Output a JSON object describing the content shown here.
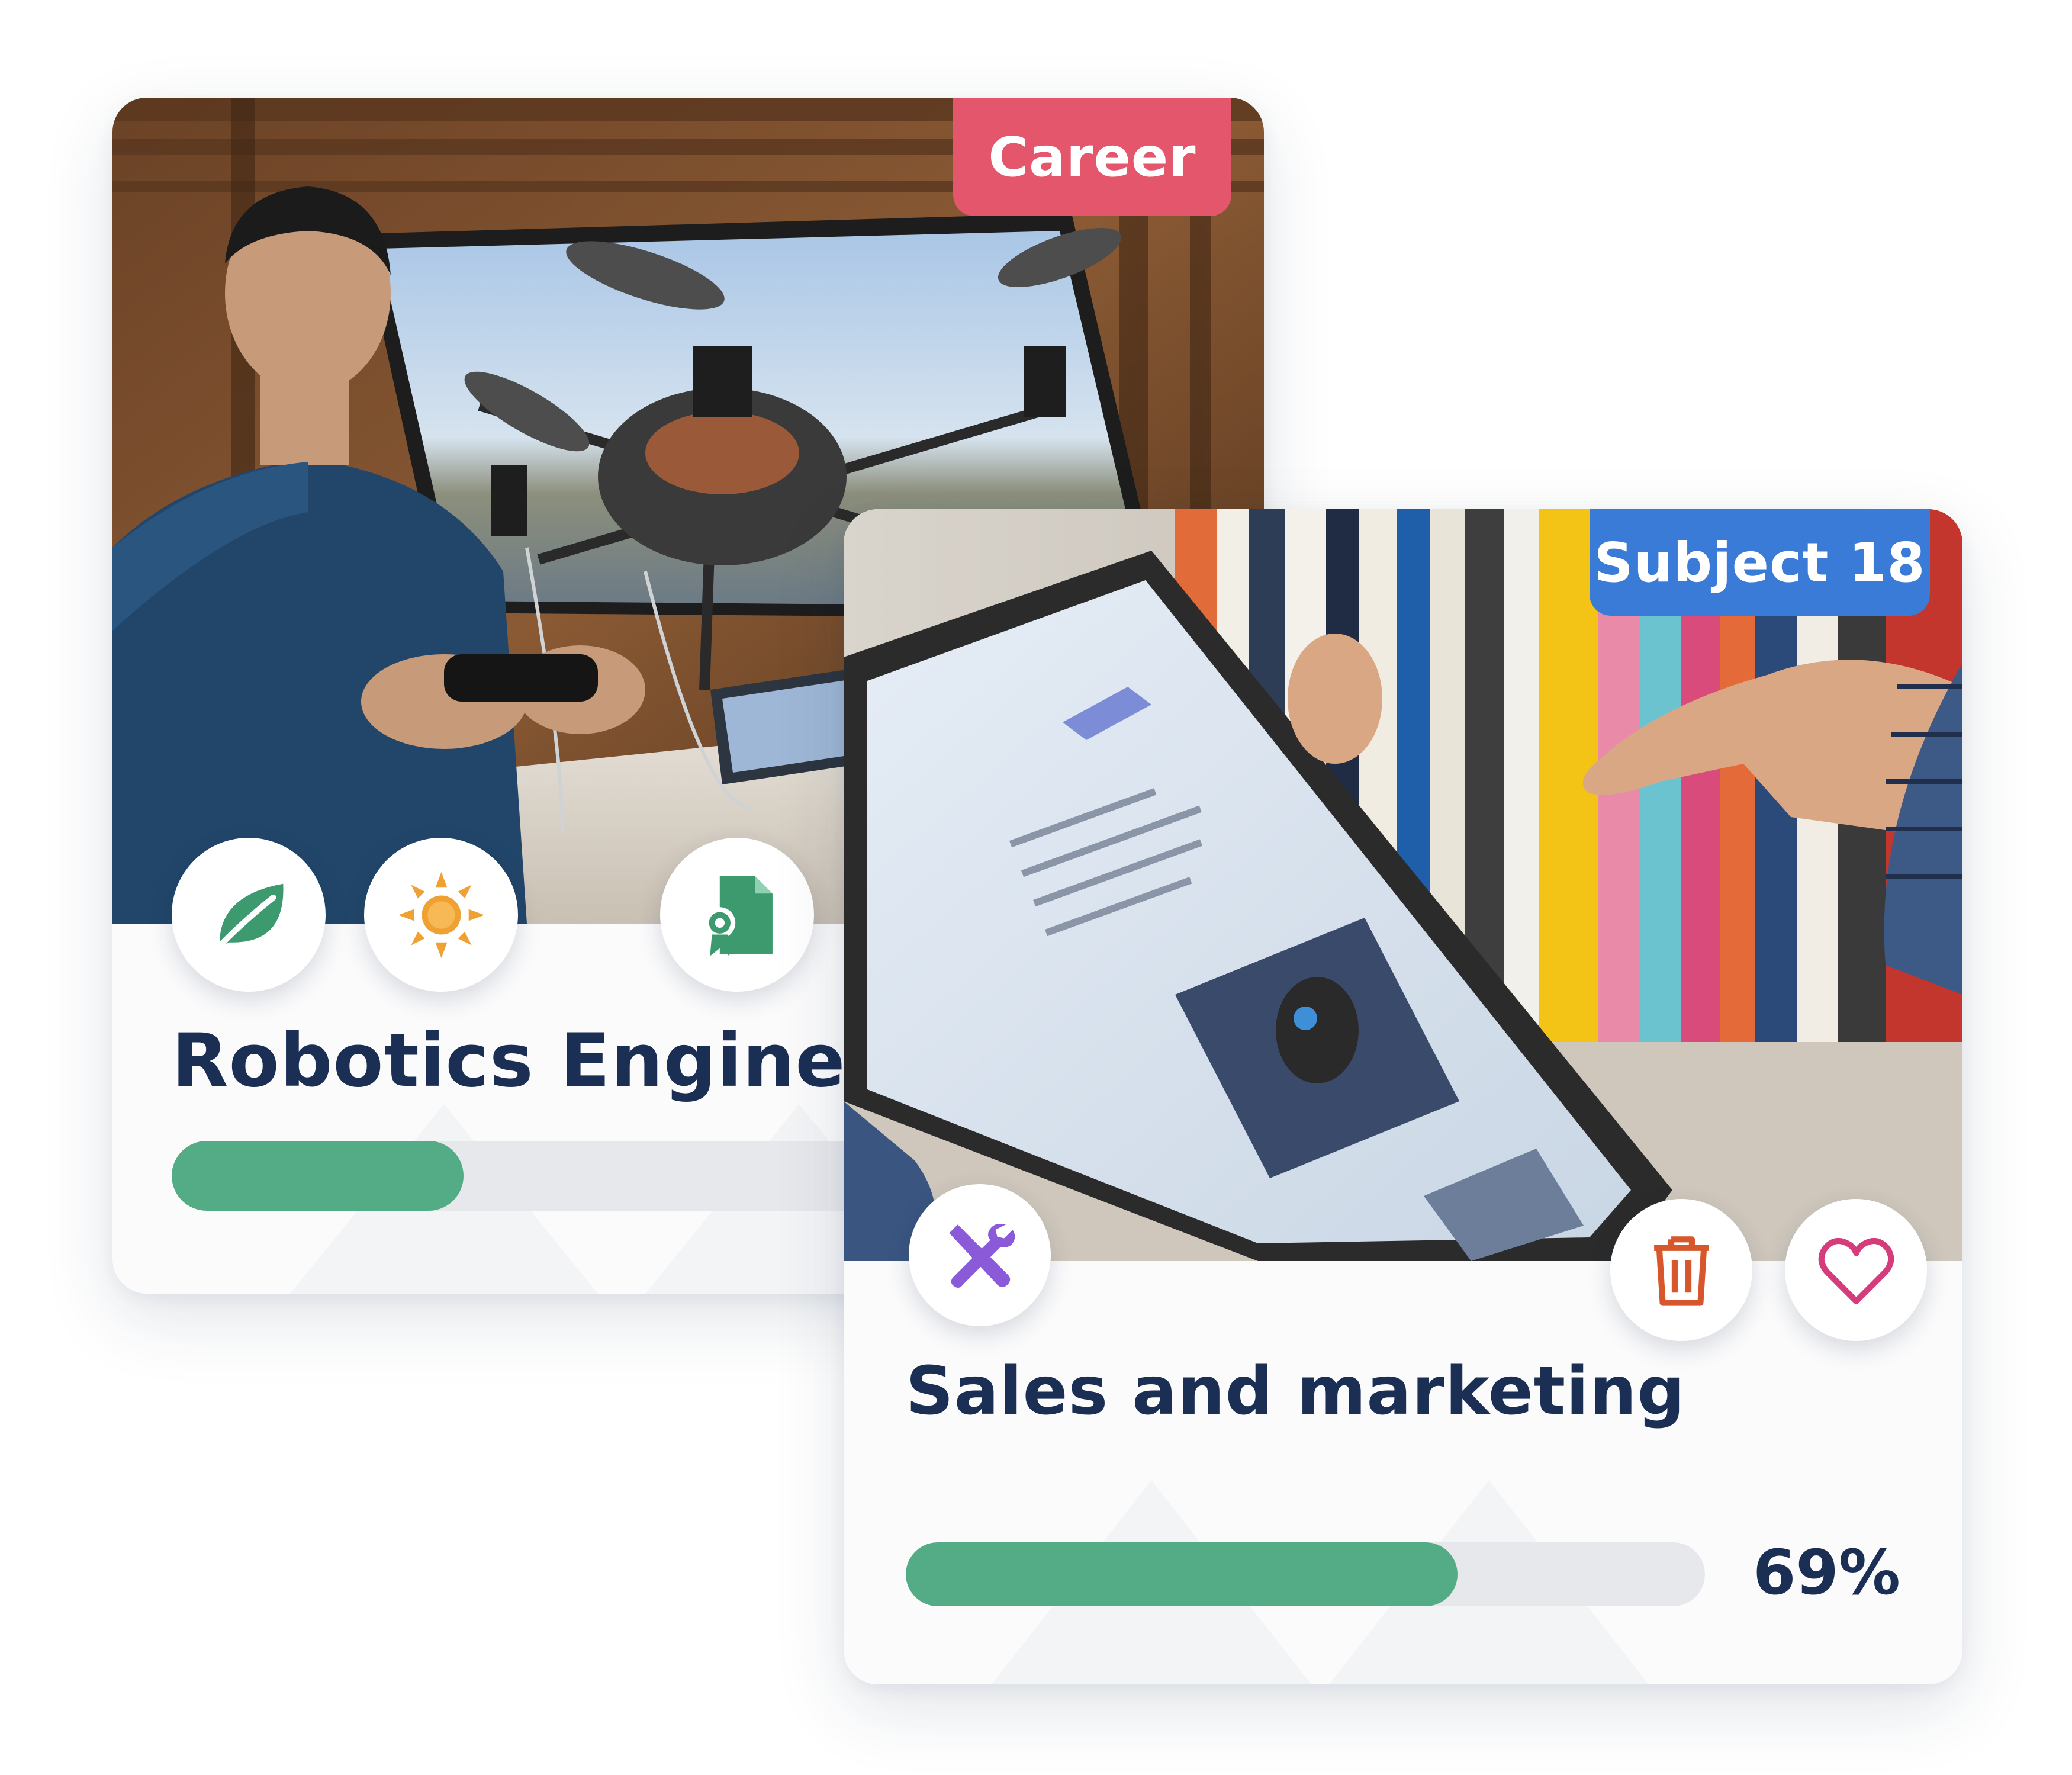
{
  "cards": [
    {
      "tag": "Career",
      "title": "Robotics Engineer",
      "icons": [
        "leaf-icon",
        "sun-icon",
        "certificate-document-icon"
      ],
      "progress": 0.29,
      "colors": {
        "tag": "#e4566c",
        "fill": "#53ac86"
      }
    },
    {
      "tag": "Subject 18",
      "title": "Sales and marketing",
      "icons": [
        "tools-icon",
        "trash-icon",
        "heart-icon"
      ],
      "progress": 0.69,
      "progress_label": "69%",
      "colors": {
        "tag": "#3b7bd8",
        "fill": "#53ac86"
      }
    }
  ]
}
